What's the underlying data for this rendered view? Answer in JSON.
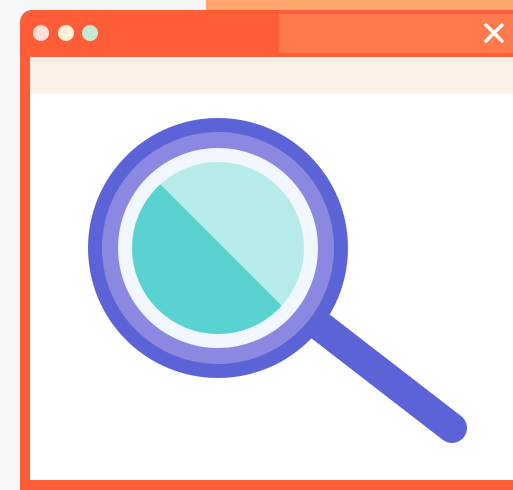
{
  "window": {
    "accent_color": "#ff5d37",
    "titlebar_dots": [
      "red",
      "yellow",
      "green"
    ]
  },
  "close_button": {
    "icon": "close-icon",
    "glyph": "✕"
  },
  "illustration": {
    "icon": "magnifying-glass-icon",
    "ring_color": "#5c63d6",
    "lens_colors": [
      "#b7ebea",
      "#58d3d2"
    ]
  }
}
